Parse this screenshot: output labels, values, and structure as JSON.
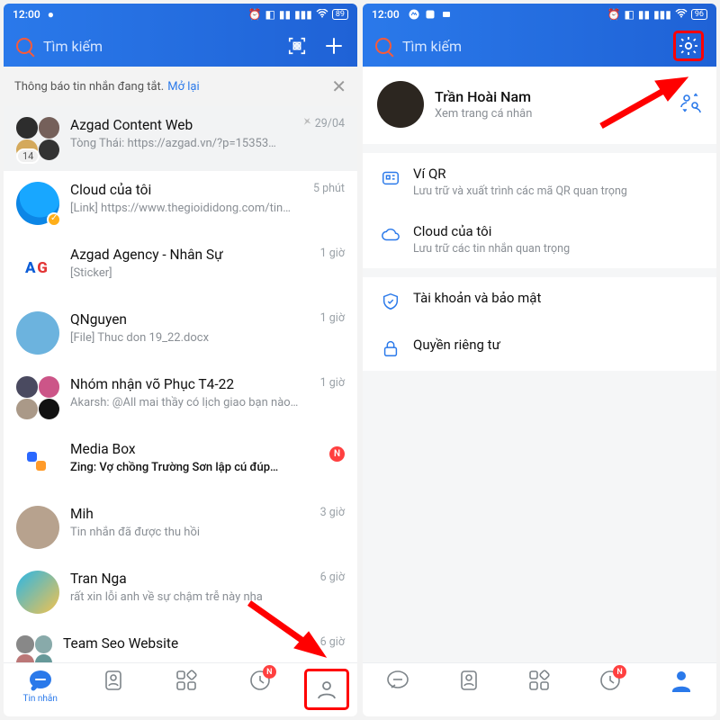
{
  "left": {
    "status_time": "12:00",
    "status_battery": "89",
    "search_placeholder": "Tìm kiếm",
    "notice_text": "Thông báo tin nhắn đang tắt.",
    "notice_link": "Mở lại",
    "chats": [
      {
        "title": "Azgad Content Web",
        "sub": "Tòng Thái: https://azgad.vn/?p=15353…",
        "time": "29/04",
        "pinned": true,
        "count": "14"
      },
      {
        "title": "Cloud của tôi",
        "sub": "[Link] https://www.thegioididong.com/tin…",
        "time": "5 phút",
        "icon": "cloud",
        "verify": true
      },
      {
        "title": "Azgad Agency - Nhân Sự",
        "sub": "[Sticker]",
        "time": "1 giờ",
        "icon": "ag"
      },
      {
        "title": "QNguyen",
        "sub": "[File] Thuc don 19_22.docx",
        "time": "1 giờ",
        "icon": "blue"
      },
      {
        "title": "Nhóm nhận võ Phục T4-22",
        "sub": "Akarsh: @All  mai thầy có lịch giao bạn nào…",
        "time": "1 giờ",
        "icon": "group2"
      },
      {
        "title": "Media Box",
        "sub": "Zing: Vợ chồng Trường Sơn lập cú đúp…",
        "time": "",
        "badge": "N",
        "icon": "mb",
        "strong": true
      },
      {
        "title": "Mih",
        "sub": "Tin nhắn đã được thu hồi",
        "time": "3 giờ",
        "icon": "cat"
      },
      {
        "title": "Tran Nga",
        "sub": "rất xin lỗi anh về sự chậm trễ này nha",
        "time": "6 giờ",
        "icon": "gold"
      },
      {
        "title": "Team Seo Website",
        "sub": "",
        "time": "6 giờ",
        "icon": "group3"
      }
    ],
    "nav": {
      "messages": "Tin nhắn",
      "badge": "N"
    }
  },
  "right": {
    "status_time": "12:00",
    "status_battery": "96",
    "search_placeholder": "Tìm kiếm",
    "profile": {
      "name": "Trần Hoài Nam",
      "hint": "Xem trang cá nhân"
    },
    "menu": [
      {
        "icon": "qr",
        "title": "Ví QR",
        "desc": "Lưu trữ và xuất trình các mã QR quan trọng"
      },
      {
        "icon": "cloud",
        "title": "Cloud của tôi",
        "desc": "Lưu trữ các tin nhắn quan trọng"
      },
      {
        "icon": "shield",
        "title": "Tài khoản và bảo mật",
        "desc": "",
        "gap": true
      },
      {
        "icon": "lock",
        "title": "Quyền riêng tư",
        "desc": ""
      }
    ],
    "nav_badge": "N"
  }
}
